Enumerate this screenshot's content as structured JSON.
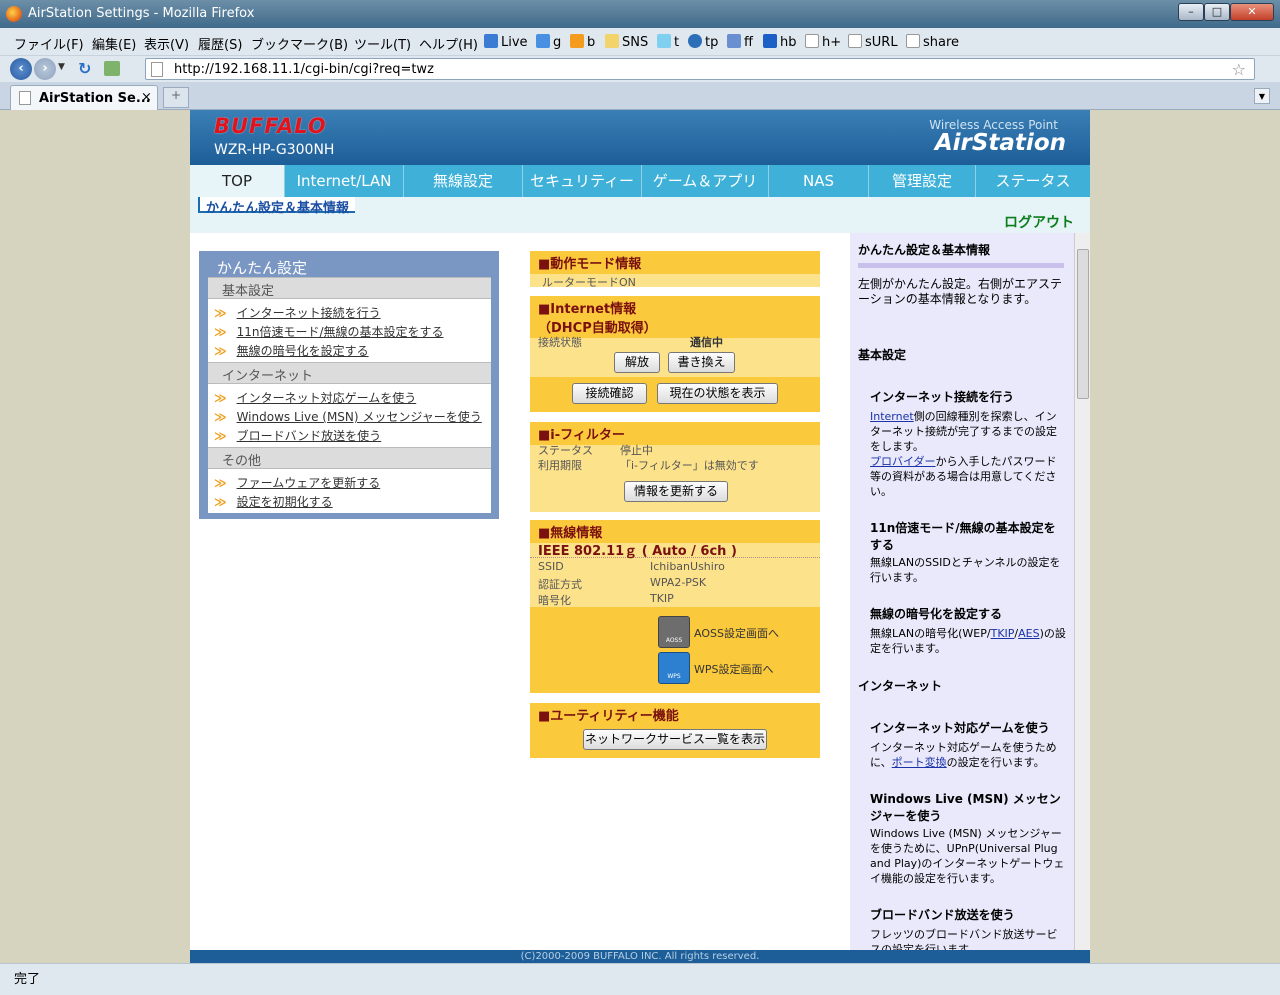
{
  "window": {
    "title": "AirStation Settings - Mozilla Firefox",
    "min": "–",
    "max": "□",
    "close": "✕"
  },
  "menus": [
    "ファイル(F)",
    "編集(E)",
    "表示(V)",
    "履歴(S)",
    "ブックマーク(B)",
    "ツール(T)",
    "ヘルプ(H)"
  ],
  "bookmarks": [
    "Live",
    "g",
    "b",
    "SNS",
    "t",
    "tp",
    "ff",
    "hb",
    "h+",
    "sURL",
    "share"
  ],
  "address": {
    "url": "http://192.168.11.1/cgi-bin/cgi?req=twz"
  },
  "tab": {
    "label": "AirStation Se...",
    "close": "×",
    "new": "+"
  },
  "status": "完了",
  "header": {
    "brand": "BUFFALO",
    "model": "WZR-HP-G300NH",
    "product_sub": "Wireless Access Point",
    "product": "AirStation"
  },
  "nav": [
    "TOP",
    "Internet/LAN",
    "無線設定",
    "セキュリティー",
    "ゲーム＆アプリ",
    "NAS",
    "管理設定",
    "ステータス"
  ],
  "subtab": "かんたん設定＆基本情報",
  "logout": "ログアウト",
  "easy": {
    "title": "かんたん設定",
    "groups": [
      {
        "label": "基本設定",
        "links": [
          "インターネット接続を行う",
          "11n倍速モード/無線の基本設定をする",
          "無線の暗号化を設定する"
        ]
      },
      {
        "label": "インターネット",
        "links": [
          "インターネット対応ゲームを使う",
          "Windows Live (MSN) メッセンジャーを使う",
          "ブロードバンド放送を使う"
        ]
      },
      {
        "label": "その他",
        "links": [
          "ファームウェアを更新する",
          "設定を初期化する"
        ]
      }
    ],
    "arrow": "≫"
  },
  "mode": {
    "title": "■動作モード情報",
    "value": "ルーターモードON"
  },
  "internet": {
    "title1": "■Internet情報",
    "title2": "（DHCP自動取得）",
    "label": "接続状態",
    "value": "通信中",
    "btn_release": "解放",
    "btn_renew": "書き換え",
    "btn_check": "接続確認",
    "btn_show": "現在の状態を表示"
  },
  "ifilter": {
    "title": "■i-フィルター",
    "rows": [
      {
        "k": "ステータス",
        "v": "停止中"
      },
      {
        "k": "利用期限",
        "v": "「i-フィルター」は無効です"
      }
    ],
    "btn": "情報を更新する"
  },
  "wireless": {
    "title": "■無線情報",
    "mode": "IEEE 802.11ｇ ( Auto / 6ch )",
    "rows": [
      {
        "k": "SSID",
        "v": "IchibanUshiro"
      },
      {
        "k": "認証方式",
        "v": "WPA2-PSK"
      },
      {
        "k": "暗号化",
        "v": "TKIP"
      }
    ],
    "aoss": "AOSS設定画面へ",
    "wps": "WPS設定画面へ",
    "aoss_icon": "AOSS",
    "wps_icon": "WPS"
  },
  "utility": {
    "title": "■ユーティリティー機能",
    "btn": "ネットワークサービス一覧を表示"
  },
  "help": {
    "title": "かんたん設定＆基本情報",
    "intro": "左側がかんたん設定。右側がエアステーションの基本情報となります。",
    "s1": "基本設定",
    "h1": "インターネット接続を行う",
    "p1a": "Internet",
    "p1b": "側の回線種別を探索し、インターネット接続が完了するまでの設定をします。",
    "p1c": "プロバイダー",
    "p1d": "から入手したパスワード等の資料がある場合は用意してください。",
    "h2": "11n倍速モード/無線の基本設定をする",
    "p2": "無線LANのSSIDとチャンネルの設定を行います。",
    "h3": "無線の暗号化を設定する",
    "p3a": "無線LANの暗号化(WEP/",
    "p3b": "TKIP",
    "p3c": "/",
    "p3d": "AES",
    "p3e": ")の設定を行います。",
    "s2": "インターネット",
    "h4": "インターネット対応ゲームを使う",
    "p4a": "インターネット対応ゲームを使うために、",
    "p4b": "ポート変換",
    "p4c": "の設定を行います。",
    "h5": "Windows Live (MSN) メッセンジャーを使う",
    "p5": "Windows Live (MSN) メッセンジャーを使うために、UPnP(Universal Plug and Play)のインターネットゲートウェイ機能の設定を行います。",
    "h6": "ブロードバンド放送を使う",
    "p6": "フレッツのブロードバンド放送サービスの設定を行います。"
  },
  "footer": "(C)2000-2009 BUFFALO INC. All rights reserved.",
  "colors": {
    "accent": "#3fb1d8",
    "header": "#1e5e98",
    "panel": "#fde28c",
    "panel_head": "#fbc93c"
  }
}
